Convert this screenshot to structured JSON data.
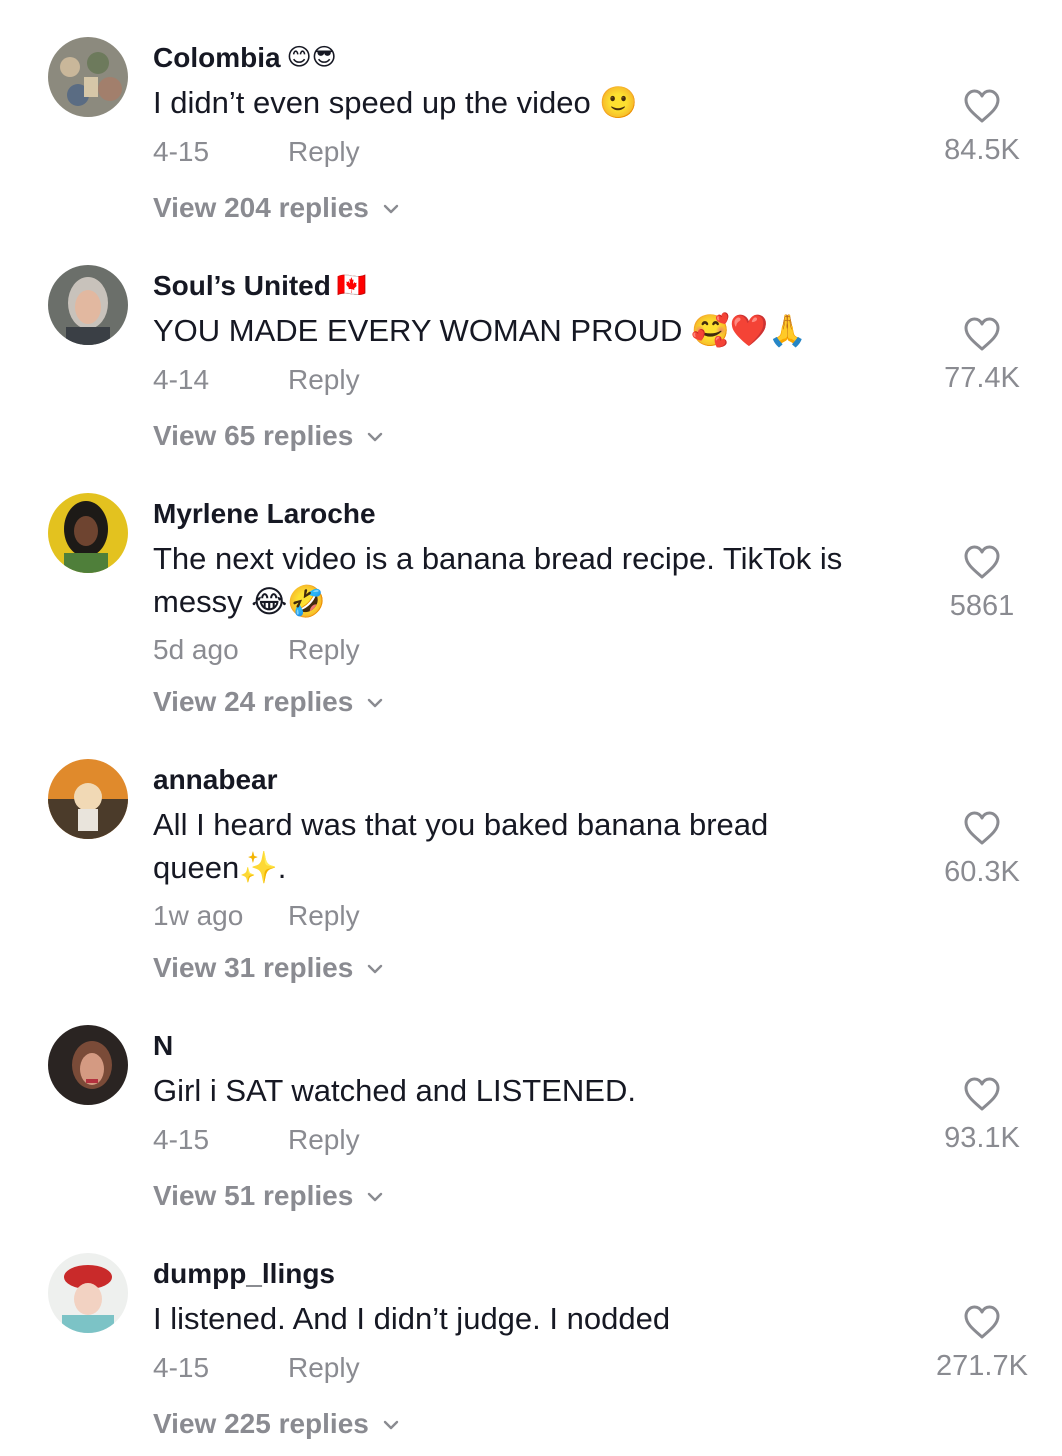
{
  "comments": [
    {
      "username": "Colombia",
      "username_emoji": "😊😎",
      "text": "I didn’t even speed up the video 🙂",
      "date": "4-15",
      "reply_label": "Reply",
      "replies_label": "View 204 replies",
      "likes": "84.5K"
    },
    {
      "username": "Soul’s United",
      "username_emoji": "🇨🇦",
      "text": "YOU MADE EVERY WOMAN PROUD 🥰❤️🙏",
      "date": "4-14",
      "reply_label": "Reply",
      "replies_label": "View 65 replies",
      "likes": "77.4K"
    },
    {
      "username": "Myrlene Laroche",
      "username_emoji": "",
      "text": "The next video is a banana bread recipe. TikTok is messy 😂🤣",
      "date": "5d ago",
      "reply_label": "Reply",
      "replies_label": "View 24 replies",
      "likes": "5861"
    },
    {
      "username": "annabear",
      "username_emoji": "",
      "text": "All I heard was that you baked banana bread queen✨.",
      "date": "1w ago",
      "reply_label": "Reply",
      "replies_label": "View 31 replies",
      "likes": "60.3K"
    },
    {
      "username": "N",
      "username_emoji": "",
      "text": "Girl i SAT watched and LISTENED.",
      "date": "4-15",
      "reply_label": "Reply",
      "replies_label": "View 51 replies",
      "likes": "93.1K"
    },
    {
      "username": "dumpp_llings",
      "username_emoji": "",
      "text": "I listened. And I didn’t judge. I nodded",
      "date": "4-15",
      "reply_label": "Reply",
      "replies_label": "View 225 replies",
      "likes": "271.7K"
    }
  ],
  "colors": {
    "primary_text": "#161823",
    "secondary_text": "#8a8b91",
    "background": "#ffffff"
  },
  "icons": {
    "like": "heart-outline-icon",
    "expand": "chevron-down-icon"
  }
}
